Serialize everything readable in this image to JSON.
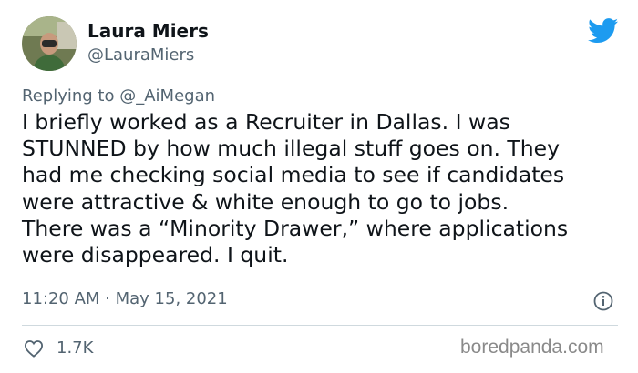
{
  "tweet": {
    "author_name": "Laura Miers",
    "author_handle": "@LauraMiers",
    "replying_prefix": "Replying to",
    "replying_handle": "@_AiMegan",
    "text": "I briefly worked as a Recruiter in Dallas. I was\nSTUNNED by how much illegal stuff goes on. They\nhad me checking social media to see if candidates\nwere attractive & white enough to go to jobs.\nThere was a “Minority Drawer,” where applications\nwere disappeared. I quit.",
    "timestamp": "11:20 AM · May 15, 2021",
    "likes": "1.7K"
  },
  "icons": {
    "platform": "twitter-bird-icon",
    "info": "info-icon",
    "like": "heart-icon"
  },
  "watermark": "boredpanda.com",
  "colors": {
    "twitter_blue": "#1d9bf0",
    "text_primary": "#0f1419",
    "text_secondary": "#536471",
    "divider": "#cfd9de"
  }
}
